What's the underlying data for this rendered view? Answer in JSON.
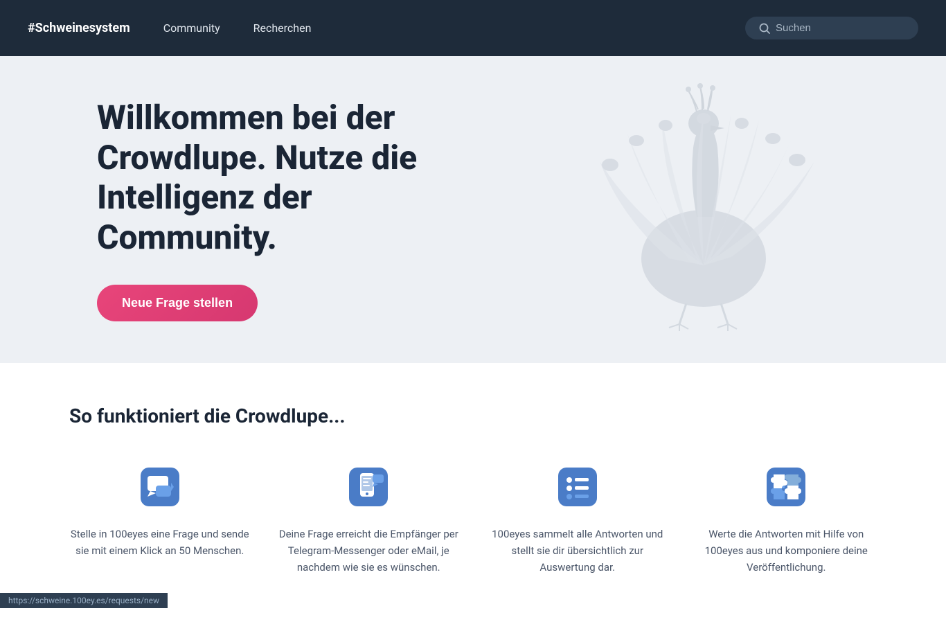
{
  "navbar": {
    "brand": "#Schweinesystem",
    "links": [
      "Community",
      "Recherchen"
    ],
    "search_placeholder": "Suchen"
  },
  "hero": {
    "title": "Willkommen bei der Crowdlupe. Nutze die Intelligenz der Community.",
    "cta_button": "Neue Frage stellen"
  },
  "how_section": {
    "title": "So funktioniert die Crowdlupe...",
    "steps": [
      {
        "icon": "chat-icon",
        "text": "Stelle in 100eyes eine Frage und sende sie mit einem Klick an 50 Menschen."
      },
      {
        "icon": "mobile-message-icon",
        "text": "Deine Frage erreicht die Empfänger per Telegram-Messenger oder eMail, je nachdem wie sie es wünschen."
      },
      {
        "icon": "list-icon",
        "text": "100eyes sammelt alle Antworten und stellt sie dir übersichtlich zur Auswertung dar."
      },
      {
        "icon": "puzzle-icon",
        "text": "Werte die Antworten mit Hilfe von 100eyes aus und komponiere deine Veröffentlichung."
      }
    ]
  },
  "statusbar": {
    "url": "https://schweine.100ey.es/requests/new"
  }
}
